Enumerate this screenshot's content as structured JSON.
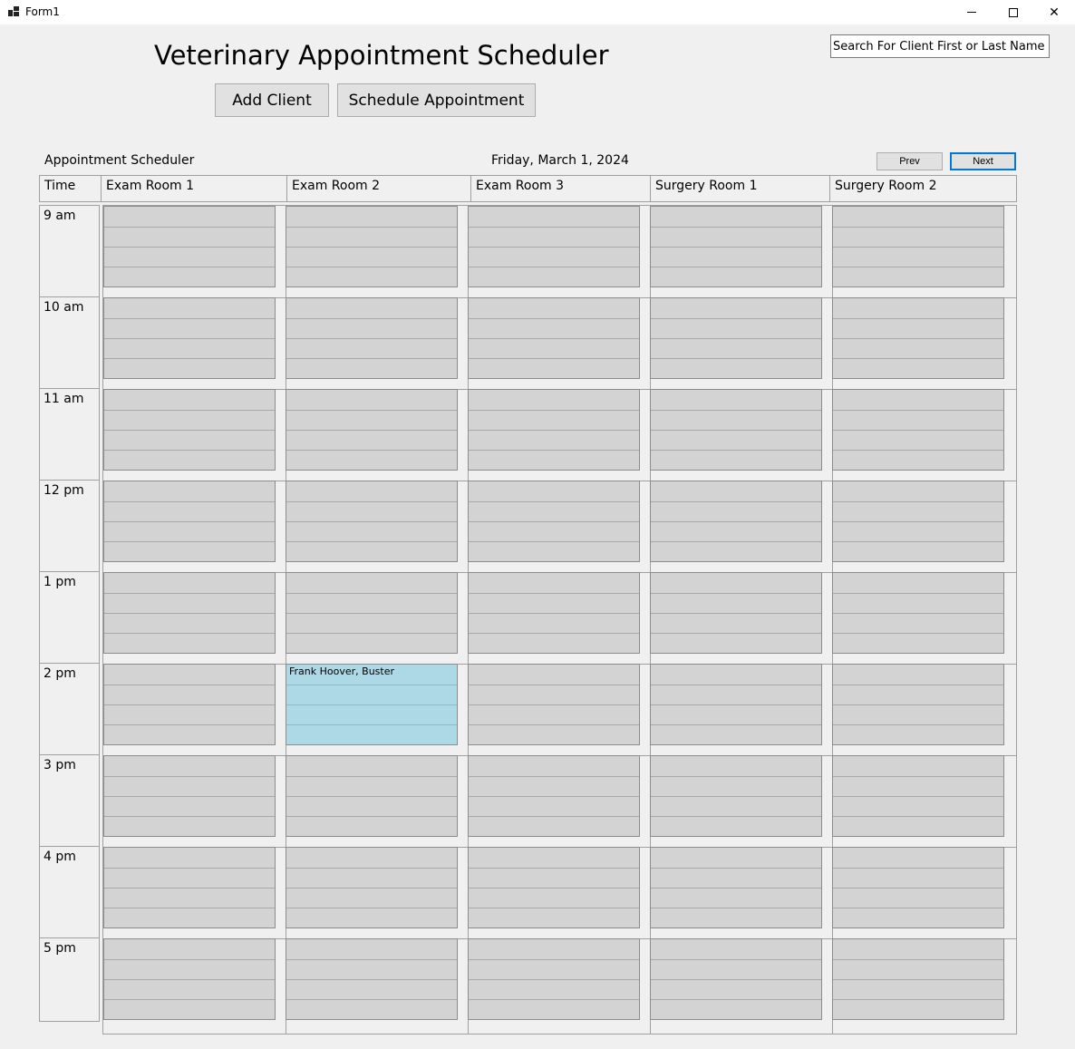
{
  "window": {
    "title": "Form1",
    "controls": {
      "minimize": "–",
      "maximize": "□",
      "close": "✕"
    }
  },
  "app": {
    "title": "Veterinary Appointment Scheduler",
    "buttons": {
      "add_client": "Add Client",
      "schedule_appointment": "Schedule Appointment"
    },
    "search": {
      "placeholder": "Search For Client First or Last Name"
    }
  },
  "scheduler": {
    "label": "Appointment Scheduler",
    "date": "Friday, March 1, 2024",
    "prev_label": "Prev",
    "next_label": "Next",
    "time_header": "Time",
    "rooms": [
      "Exam Room 1",
      "Exam Room 2",
      "Exam Room 3",
      "Surgery Room 1",
      "Surgery Room 2"
    ],
    "times": [
      "9 am",
      "10 am",
      "11 am",
      "12 pm",
      "1 pm",
      "2 pm",
      "3 pm",
      "4 pm",
      "5 pm"
    ],
    "appointments": [
      {
        "room_index": 1,
        "time_index": 5,
        "label": "Frank Hoover, Buster",
        "color": "#add8e6"
      }
    ],
    "colors": {
      "empty_slot": "#d3d3d3",
      "booked_slot": "#add8e6",
      "accent": "#0078d7"
    }
  }
}
